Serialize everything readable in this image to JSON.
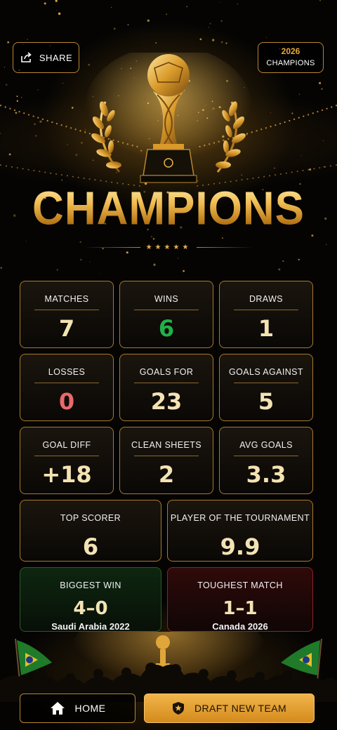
{
  "header": {
    "share_label": "SHARE",
    "badge_year": "2026",
    "badge_text": "CHAMPIONS"
  },
  "title": "CHAMPIONS",
  "divider_stars": "★★★★★",
  "stats": [
    {
      "label": "MATCHES",
      "value": "7"
    },
    {
      "label": "WINS",
      "value": "6"
    },
    {
      "label": "DRAWS",
      "value": "1"
    },
    {
      "label": "LOSSES",
      "value": "0"
    },
    {
      "label": "GOALS FOR",
      "value": "23"
    },
    {
      "label": "GOALS AGAINST",
      "value": "5"
    },
    {
      "label": "GOAL DIFF",
      "value": "+18"
    },
    {
      "label": "CLEAN SHEETS",
      "value": "2"
    },
    {
      "label": "AVG GOALS",
      "value": "3.3"
    }
  ],
  "highlights": [
    {
      "label": "TOP SCORER",
      "value": "6"
    },
    {
      "label": "PLAYER OF THE TOURNAMENT",
      "value": "9.9"
    }
  ],
  "results": [
    {
      "label": "BIGGEST WIN",
      "value": "4–0",
      "detail": "Saudi Arabia 2022"
    },
    {
      "label": "TOUGHEST MATCH",
      "value": "1–1",
      "detail": "Canada 2026"
    }
  ],
  "footer": {
    "home_label": "HOME",
    "draft_label": "DRAFT NEW TEAM"
  },
  "colors": {
    "gold": "#e8a93a",
    "card_border": "#a87a2c",
    "win_green": "#22b04a",
    "loss_red": "#e86a6a",
    "button_gold": "#f0b54a"
  },
  "icons": [
    "share-icon",
    "trophy-icon",
    "laurel-icon",
    "home-icon",
    "shield-star-icon",
    "flag-icon"
  ]
}
